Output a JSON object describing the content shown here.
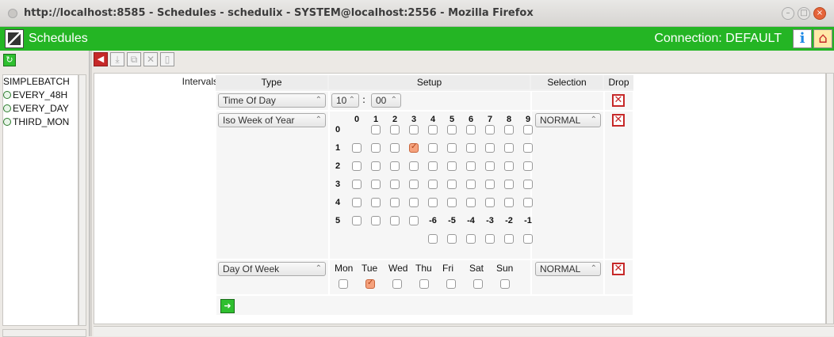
{
  "window": {
    "title": "http://localhost:8585 - Schedules - schedulix - SYSTEM@localhost:2556 - Mozilla Firefox"
  },
  "app": {
    "name": "Schedules",
    "connection": "Connection: DEFAULT"
  },
  "tree": {
    "items": [
      "SIMPLEBATCH",
      "EVERY_48H",
      "EVERY_DAY",
      "THIRD_MON"
    ]
  },
  "form": {
    "intervals_label": "Intervals",
    "headers": {
      "type": "Type",
      "setup": "Setup",
      "selection": "Selection",
      "drop": "Drop"
    },
    "rows": [
      {
        "type": "Time Of Day",
        "hour": "10",
        "minute": "00",
        "selection": ""
      },
      {
        "type": "Iso Week of Year",
        "selection": "NORMAL"
      },
      {
        "type": "Day Of Week",
        "selection": "NORMAL"
      }
    ],
    "time_sep": ":",
    "week_col_headers": [
      "0",
      "1",
      "2",
      "3",
      "4",
      "5",
      "6",
      "7",
      "8",
      "9"
    ],
    "week_row_labels": [
      "0",
      "1",
      "2",
      "3",
      "4",
      "5"
    ],
    "neg_labels": [
      "-6",
      "-5",
      "-4",
      "-3",
      "-2",
      "-1"
    ],
    "week_checked": [
      13
    ],
    "days": [
      "Mon",
      "Tue",
      "Wed",
      "Thu",
      "Fri",
      "Sat",
      "Sun"
    ],
    "days_checked": [
      1
    ]
  },
  "colors": {
    "green": "#24b524",
    "accent": "#c62828"
  }
}
